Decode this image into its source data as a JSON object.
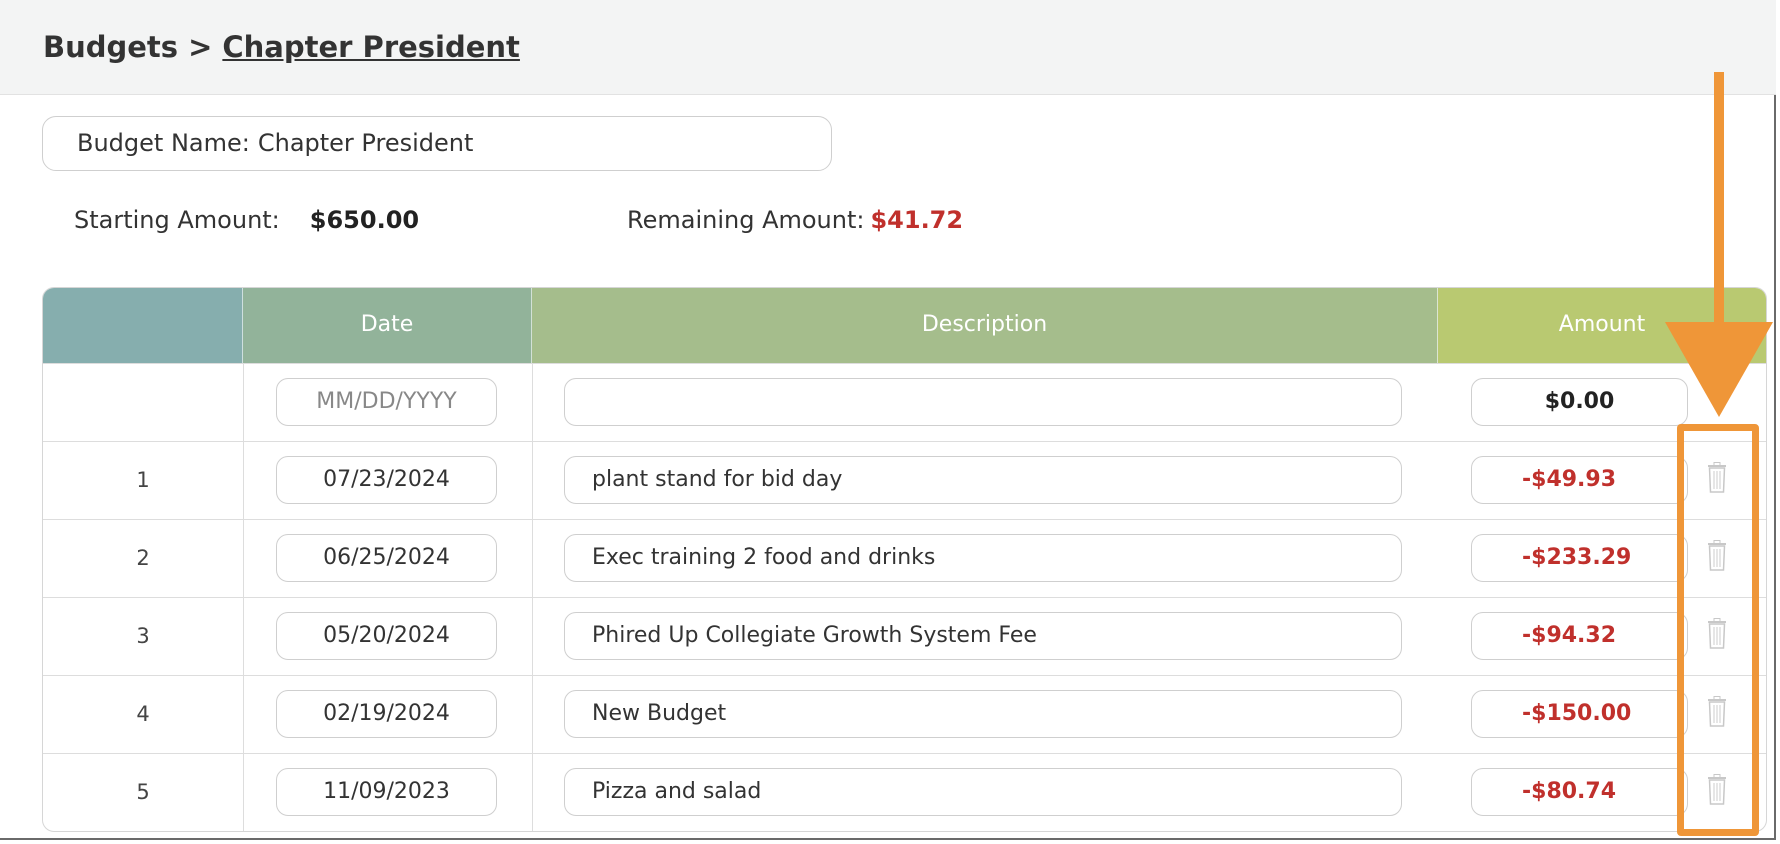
{
  "breadcrumb": {
    "root": "Budgets",
    "separator": ">",
    "current": "Chapter President"
  },
  "budget_name": {
    "label": "Budget Name:",
    "value": "Chapter President"
  },
  "summary": {
    "starting_label": "Starting Amount:",
    "starting_value": "$650.00",
    "remaining_label": "Remaining Amount:",
    "remaining_value": "$41.72",
    "remaining_color": "#c0302c"
  },
  "table": {
    "headers": {
      "number": "",
      "date": "Date",
      "description": "Description",
      "amount": "Amount"
    },
    "new_entry": {
      "date_placeholder": "MM/DD/YYYY",
      "description": "",
      "amount": "$0.00"
    },
    "rows": [
      {
        "num": "1",
        "date": "07/23/2024",
        "description": "plant stand for bid day",
        "amount": "-$49.93",
        "action_icon": "trash-icon"
      },
      {
        "num": "2",
        "date": "06/25/2024",
        "description": "Exec training 2 food and drinks",
        "amount": "-$233.29",
        "action_icon": "trash-icon"
      },
      {
        "num": "3",
        "date": "05/20/2024",
        "description": "Phired Up Collegiate Growth System Fee",
        "amount": "-$94.32",
        "action_icon": "trash-icon"
      },
      {
        "num": "4",
        "date": "02/19/2024",
        "description": "New Budget",
        "amount": "-$150.00",
        "action_icon": "trash-icon"
      },
      {
        "num": "5",
        "date": "11/09/2023",
        "description": "Pizza and salad",
        "amount": "-$80.74",
        "action_icon": "trash-icon"
      }
    ]
  },
  "annotation": {
    "color": "#ef9638",
    "arrow_icon": "down-arrow-icon"
  }
}
